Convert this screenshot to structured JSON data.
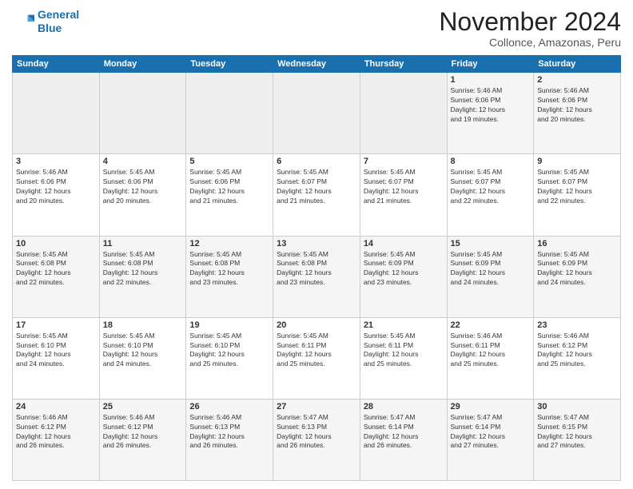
{
  "logo": {
    "line1": "General",
    "line2": "Blue"
  },
  "title": "November 2024",
  "subtitle": "Collonce, Amazonas, Peru",
  "weekdays": [
    "Sunday",
    "Monday",
    "Tuesday",
    "Wednesday",
    "Thursday",
    "Friday",
    "Saturday"
  ],
  "weeks": [
    [
      {
        "day": "",
        "info": ""
      },
      {
        "day": "",
        "info": ""
      },
      {
        "day": "",
        "info": ""
      },
      {
        "day": "",
        "info": ""
      },
      {
        "day": "",
        "info": ""
      },
      {
        "day": "1",
        "info": "Sunrise: 5:46 AM\nSunset: 6:06 PM\nDaylight: 12 hours\nand 19 minutes."
      },
      {
        "day": "2",
        "info": "Sunrise: 5:46 AM\nSunset: 6:06 PM\nDaylight: 12 hours\nand 20 minutes."
      }
    ],
    [
      {
        "day": "3",
        "info": "Sunrise: 5:46 AM\nSunset: 6:06 PM\nDaylight: 12 hours\nand 20 minutes."
      },
      {
        "day": "4",
        "info": "Sunrise: 5:45 AM\nSunset: 6:06 PM\nDaylight: 12 hours\nand 20 minutes."
      },
      {
        "day": "5",
        "info": "Sunrise: 5:45 AM\nSunset: 6:06 PM\nDaylight: 12 hours\nand 21 minutes."
      },
      {
        "day": "6",
        "info": "Sunrise: 5:45 AM\nSunset: 6:07 PM\nDaylight: 12 hours\nand 21 minutes."
      },
      {
        "day": "7",
        "info": "Sunrise: 5:45 AM\nSunset: 6:07 PM\nDaylight: 12 hours\nand 21 minutes."
      },
      {
        "day": "8",
        "info": "Sunrise: 5:45 AM\nSunset: 6:07 PM\nDaylight: 12 hours\nand 22 minutes."
      },
      {
        "day": "9",
        "info": "Sunrise: 5:45 AM\nSunset: 6:07 PM\nDaylight: 12 hours\nand 22 minutes."
      }
    ],
    [
      {
        "day": "10",
        "info": "Sunrise: 5:45 AM\nSunset: 6:08 PM\nDaylight: 12 hours\nand 22 minutes."
      },
      {
        "day": "11",
        "info": "Sunrise: 5:45 AM\nSunset: 6:08 PM\nDaylight: 12 hours\nand 22 minutes."
      },
      {
        "day": "12",
        "info": "Sunrise: 5:45 AM\nSunset: 6:08 PM\nDaylight: 12 hours\nand 23 minutes."
      },
      {
        "day": "13",
        "info": "Sunrise: 5:45 AM\nSunset: 6:08 PM\nDaylight: 12 hours\nand 23 minutes."
      },
      {
        "day": "14",
        "info": "Sunrise: 5:45 AM\nSunset: 6:09 PM\nDaylight: 12 hours\nand 23 minutes."
      },
      {
        "day": "15",
        "info": "Sunrise: 5:45 AM\nSunset: 6:09 PM\nDaylight: 12 hours\nand 24 minutes."
      },
      {
        "day": "16",
        "info": "Sunrise: 5:45 AM\nSunset: 6:09 PM\nDaylight: 12 hours\nand 24 minutes."
      }
    ],
    [
      {
        "day": "17",
        "info": "Sunrise: 5:45 AM\nSunset: 6:10 PM\nDaylight: 12 hours\nand 24 minutes."
      },
      {
        "day": "18",
        "info": "Sunrise: 5:45 AM\nSunset: 6:10 PM\nDaylight: 12 hours\nand 24 minutes."
      },
      {
        "day": "19",
        "info": "Sunrise: 5:45 AM\nSunset: 6:10 PM\nDaylight: 12 hours\nand 25 minutes."
      },
      {
        "day": "20",
        "info": "Sunrise: 5:45 AM\nSunset: 6:11 PM\nDaylight: 12 hours\nand 25 minutes."
      },
      {
        "day": "21",
        "info": "Sunrise: 5:45 AM\nSunset: 6:11 PM\nDaylight: 12 hours\nand 25 minutes."
      },
      {
        "day": "22",
        "info": "Sunrise: 5:46 AM\nSunset: 6:11 PM\nDaylight: 12 hours\nand 25 minutes."
      },
      {
        "day": "23",
        "info": "Sunrise: 5:46 AM\nSunset: 6:12 PM\nDaylight: 12 hours\nand 25 minutes."
      }
    ],
    [
      {
        "day": "24",
        "info": "Sunrise: 5:46 AM\nSunset: 6:12 PM\nDaylight: 12 hours\nand 26 minutes."
      },
      {
        "day": "25",
        "info": "Sunrise: 5:46 AM\nSunset: 6:12 PM\nDaylight: 12 hours\nand 26 minutes."
      },
      {
        "day": "26",
        "info": "Sunrise: 5:46 AM\nSunset: 6:13 PM\nDaylight: 12 hours\nand 26 minutes."
      },
      {
        "day": "27",
        "info": "Sunrise: 5:47 AM\nSunset: 6:13 PM\nDaylight: 12 hours\nand 26 minutes."
      },
      {
        "day": "28",
        "info": "Sunrise: 5:47 AM\nSunset: 6:14 PM\nDaylight: 12 hours\nand 26 minutes."
      },
      {
        "day": "29",
        "info": "Sunrise: 5:47 AM\nSunset: 6:14 PM\nDaylight: 12 hours\nand 27 minutes."
      },
      {
        "day": "30",
        "info": "Sunrise: 5:47 AM\nSunset: 6:15 PM\nDaylight: 12 hours\nand 27 minutes."
      }
    ]
  ]
}
